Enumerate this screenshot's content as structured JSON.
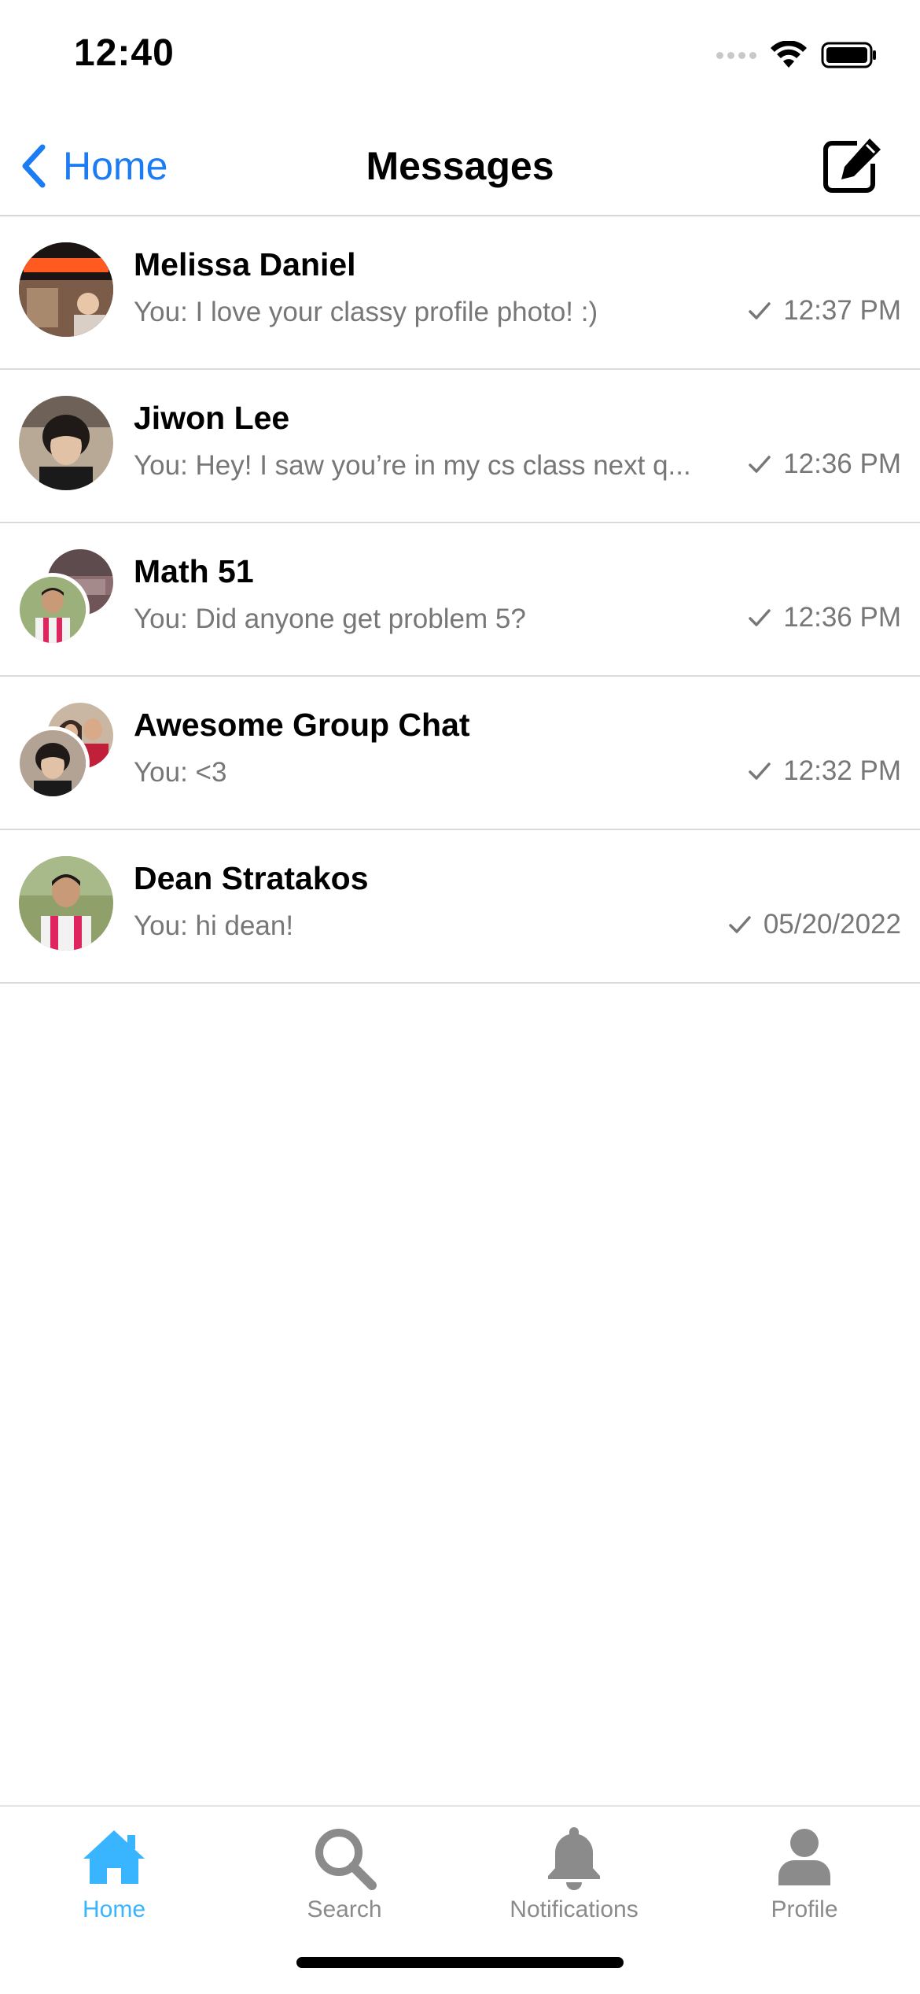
{
  "status_bar": {
    "time": "12:40"
  },
  "nav": {
    "back_label": "Home",
    "title": "Messages",
    "compose_icon": "compose-icon"
  },
  "conversations": [
    {
      "name": "Melissa Daniel",
      "preview": "You: I love your classy profile photo! :)",
      "time": "12:37 PM",
      "avatar": "single",
      "sent": true
    },
    {
      "name": "Jiwon Lee",
      "preview": "You: Hey! I saw you’re in my cs class next q...",
      "time": "12:36 PM",
      "avatar": "single",
      "sent": true
    },
    {
      "name": "Math 51",
      "preview": "You: Did anyone get problem 5?",
      "time": "12:36 PM",
      "avatar": "group",
      "sent": true
    },
    {
      "name": "Awesome Group Chat",
      "preview": "You: <3",
      "time": "12:32 PM",
      "avatar": "group",
      "sent": true
    },
    {
      "name": "Dean Stratakos",
      "preview": "You: hi dean!",
      "time": "05/20/2022",
      "avatar": "single",
      "sent": true
    }
  ],
  "tab_bar": {
    "tabs": [
      {
        "label": "Home",
        "icon": "home-icon",
        "active": true
      },
      {
        "label": "Search",
        "icon": "search-icon",
        "active": false
      },
      {
        "label": "Notifications",
        "icon": "bell-icon",
        "active": false
      },
      {
        "label": "Profile",
        "icon": "person-icon",
        "active": false
      }
    ]
  },
  "colors": {
    "accent_blue": "#1c7cf3",
    "tab_active": "#39b5ff",
    "tab_inactive": "#8b8b8b",
    "secondary_text": "#777777"
  }
}
